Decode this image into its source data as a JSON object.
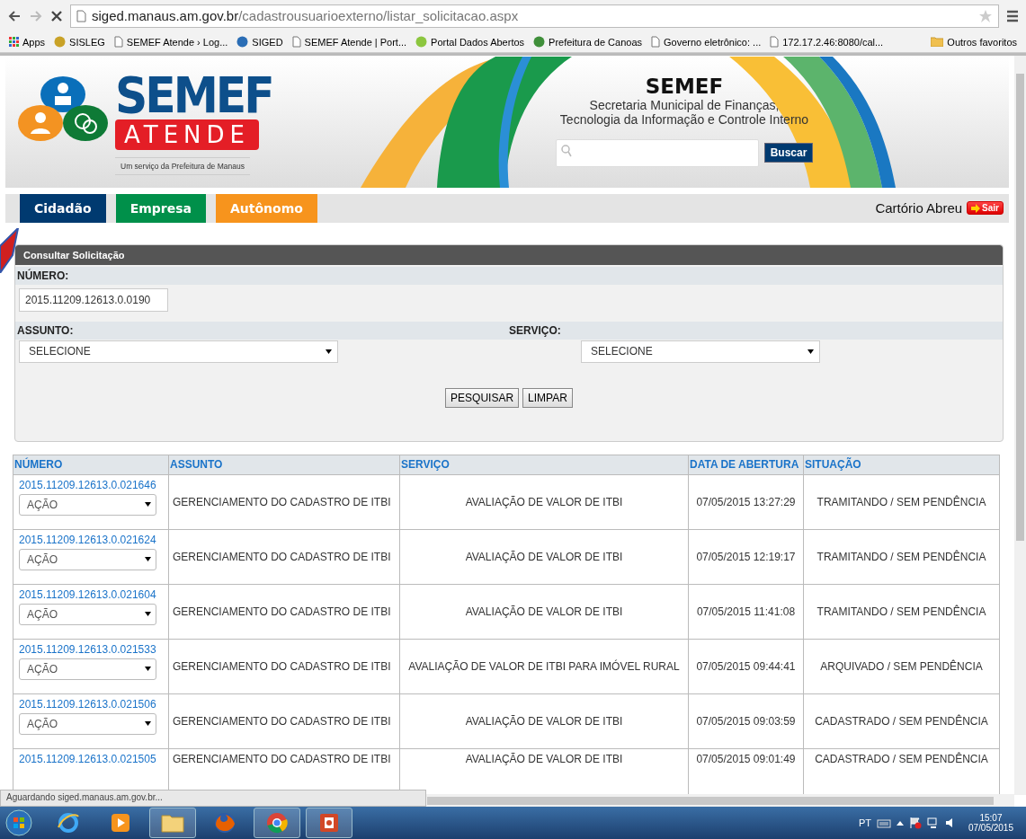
{
  "browser": {
    "url_host": "siged.manaus.am.gov.br",
    "url_path": "/cadastrousuarioexterno/listar_solicitacao.aspx",
    "bookmarks": [
      {
        "kind": "apps",
        "label": "Apps"
      },
      {
        "kind": "site",
        "color": "#c9a227",
        "label": "SISLEG"
      },
      {
        "kind": "page",
        "label": "SEMEF Atende › Log..."
      },
      {
        "kind": "site",
        "color": "#2a6db5",
        "label": "SIGED"
      },
      {
        "kind": "page",
        "label": "SEMEF Atende | Port..."
      },
      {
        "kind": "site",
        "color": "#8cc63f",
        "label": "Portal Dados Abertos"
      },
      {
        "kind": "site",
        "color": "#3f8f3a",
        "label": "Prefeitura de Canoas"
      },
      {
        "kind": "page",
        "label": "Governo eletrônico: ..."
      },
      {
        "kind": "page",
        "label": "172.17.2.46:8080/cal..."
      }
    ],
    "other_bookmarks": "Outros favoritos"
  },
  "header": {
    "logo_title": "SEMEF",
    "logo_subtitle": "ATENDE",
    "logo_tagline": "Um serviço da Prefeitura de Manaus",
    "org_title": "SEMEF",
    "org_lines": [
      "Secretaria Municipal de Finanças,",
      "Tecnologia da Informação e Controle Interno"
    ],
    "search_button": "Buscar"
  },
  "nav": {
    "tabs": [
      {
        "label": "Cidadão",
        "color": "#003a70"
      },
      {
        "label": "Empresa",
        "color": "#00904a"
      },
      {
        "label": "Autônomo",
        "color": "#f7941d"
      }
    ],
    "user": "Cartório Abreu",
    "logout": "Sair"
  },
  "panel": {
    "title": "Consultar Solicitação",
    "number_label": "NÚMERO:",
    "number_value": "2015.11209.12613.0.0190",
    "subject_label": "ASSUNTO:",
    "subject_value": "SELECIONE",
    "service_label": "SERVIÇO:",
    "service_value": "SELECIONE",
    "buttons": [
      "PESQUISAR",
      "LIMPAR"
    ]
  },
  "table": {
    "columns": [
      "NÚMERO",
      "ASSUNTO",
      "SERVIÇO",
      "DATA DE ABERTURA",
      "SITUAÇÃO"
    ],
    "rows": [
      {
        "number": "2015.11209.12613.0.021646",
        "action": "AÇÃO",
        "subject": "GERENCIAMENTO DO CADASTRO DE ITBI",
        "service": "AVALIAÇÃO DE VALOR DE ITBI",
        "date": "07/05/2015 13:27:29",
        "status": "TRAMITANDO / SEM PENDÊNCIA"
      },
      {
        "number": "2015.11209.12613.0.021624",
        "action": "AÇÃO",
        "subject": "GERENCIAMENTO DO CADASTRO DE ITBI",
        "service": "AVALIAÇÃO DE VALOR DE ITBI",
        "date": "07/05/2015 12:19:17",
        "status": "TRAMITANDO / SEM PENDÊNCIA"
      },
      {
        "number": "2015.11209.12613.0.021604",
        "action": "AÇÃO",
        "subject": "GERENCIAMENTO DO CADASTRO DE ITBI",
        "service": "AVALIAÇÃO DE VALOR DE ITBI",
        "date": "07/05/2015 11:41:08",
        "status": "TRAMITANDO / SEM PENDÊNCIA"
      },
      {
        "number": "2015.11209.12613.0.021533",
        "action": "AÇÃO",
        "subject": "GERENCIAMENTO DO CADASTRO DE ITBI",
        "service": "AVALIAÇÃO DE VALOR DE ITBI PARA IMÓVEL RURAL",
        "date": "07/05/2015 09:44:41",
        "status": "ARQUIVADO / SEM PENDÊNCIA"
      },
      {
        "number": "2015.11209.12613.0.021506",
        "action": "AÇÃO",
        "subject": "GERENCIAMENTO DO CADASTRO DE ITBI",
        "service": "AVALIAÇÃO DE VALOR DE ITBI",
        "date": "07/05/2015 09:03:59",
        "status": "CADASTRADO / SEM PENDÊNCIA"
      },
      {
        "number": "2015.11209.12613.0.021505",
        "subject": "GERENCIAMENTO DO CADASTRO DE ITBI",
        "service": "AVALIAÇÃO DE VALOR DE ITBI",
        "date": "07/05/2015 09:01:49",
        "status": "CADASTRADO / SEM PENDÊNCIA"
      }
    ]
  },
  "status_text": "Aguardando siged.manaus.am.gov.br...",
  "taskbar": {
    "apps": [
      {
        "kind": "ie",
        "running": false
      },
      {
        "kind": "media",
        "running": false
      },
      {
        "kind": "explorer",
        "running": true
      },
      {
        "kind": "firefox",
        "running": false
      },
      {
        "kind": "chrome",
        "running": true
      },
      {
        "kind": "powerpoint",
        "running": true
      }
    ],
    "language": "PT",
    "time": "15:07",
    "date": "07/05/2015"
  }
}
